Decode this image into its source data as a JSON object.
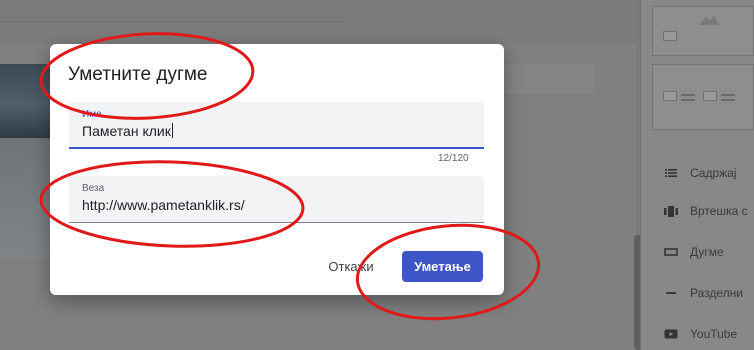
{
  "dialog": {
    "title": "Уметните дугме",
    "name_field": {
      "label": "Име",
      "value": "Паметан клик",
      "counter": "12/120"
    },
    "link_field": {
      "label": "Веза",
      "value": "http://www.pametanklik.rs/"
    },
    "cancel_label": "Откажи",
    "insert_label": "Уметање"
  },
  "right_panel": {
    "items": [
      {
        "label": "Садржај",
        "icon": "list-icon"
      },
      {
        "label": "Вртешка с",
        "icon": "carousel-icon"
      },
      {
        "label": "Дугме",
        "icon": "button-icon"
      },
      {
        "label": "Разделни",
        "icon": "divider-icon"
      },
      {
        "label": "YouTube",
        "icon": "youtube-icon"
      }
    ]
  },
  "colors": {
    "accent": "#3c55c7",
    "annotation": "#e01919",
    "backdrop": "#7c7c7c"
  }
}
